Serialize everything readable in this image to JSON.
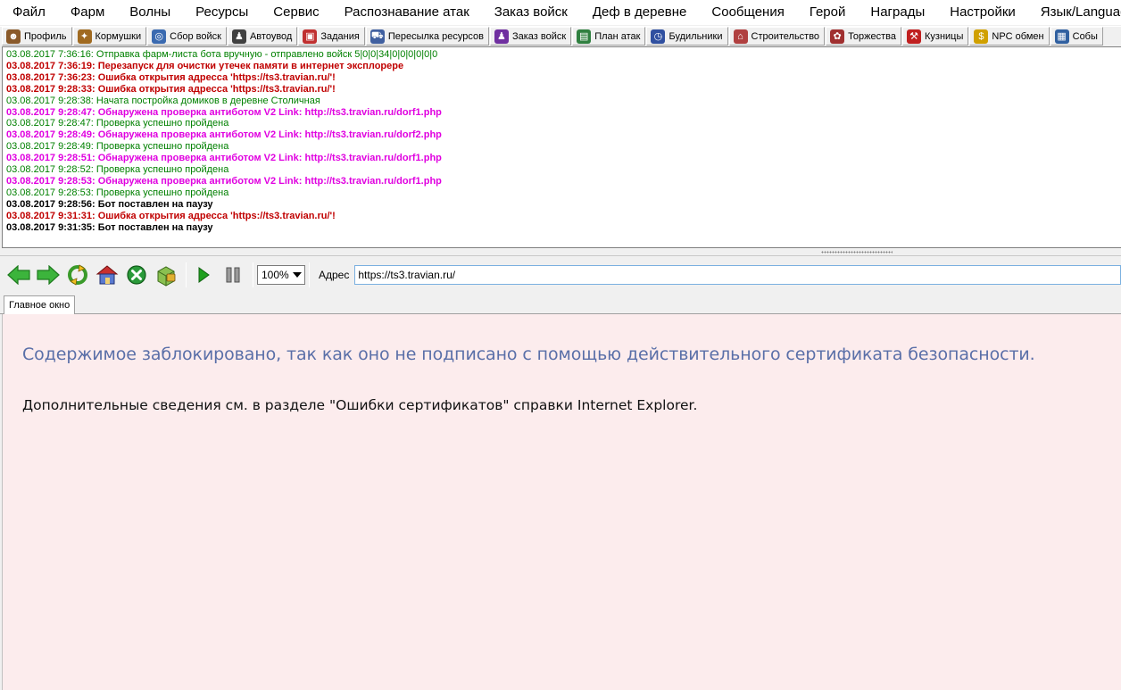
{
  "menu": [
    "Файл",
    "Фарм",
    "Волны",
    "Ресурсы",
    "Сервис",
    "Распознавание атак",
    "Заказ войск",
    "Деф в деревне",
    "Сообщения",
    "Герой",
    "Награды",
    "Настройки",
    "Язык/Language"
  ],
  "toolbar": [
    {
      "label": "Профиль",
      "icon": "profile-icon",
      "color": "#8a5a2a",
      "glyph": "☻"
    },
    {
      "label": "Кормушки",
      "icon": "feeder-icon",
      "color": "#a06a20",
      "glyph": "✦"
    },
    {
      "label": "Сбор войск",
      "icon": "gather-icon",
      "color": "#3a6ab0",
      "glyph": "◎"
    },
    {
      "label": "Автоувод",
      "icon": "autoevade-icon",
      "color": "#404040",
      "glyph": "♟"
    },
    {
      "label": "Задания",
      "icon": "tasks-icon",
      "color": "#c03030",
      "glyph": "▣"
    },
    {
      "label": "Пересылка ресурсов",
      "icon": "resources-icon",
      "color": "#4060a0",
      "glyph": "⛟"
    },
    {
      "label": "Заказ войск",
      "icon": "order-troops-icon",
      "color": "#7030a0",
      "glyph": "♟"
    },
    {
      "label": "План атак",
      "icon": "attack-plan-icon",
      "color": "#308040",
      "glyph": "▤"
    },
    {
      "label": "Будильники",
      "icon": "alarm-icon",
      "color": "#3050a0",
      "glyph": "◷"
    },
    {
      "label": "Строительство",
      "icon": "build-icon",
      "color": "#b04040",
      "glyph": "⌂"
    },
    {
      "label": "Торжества",
      "icon": "celebration-icon",
      "color": "#a03030",
      "glyph": "✿"
    },
    {
      "label": "Кузницы",
      "icon": "smithy-icon",
      "color": "#c02020",
      "glyph": "⚒"
    },
    {
      "label": "NPC обмен",
      "icon": "npc-exchange-icon",
      "color": "#d0a000",
      "glyph": "$"
    },
    {
      "label": "Собы",
      "icon": "events-icon",
      "color": "#3060a0",
      "glyph": "▦"
    }
  ],
  "log": [
    {
      "text": "03.08.2017 7:36:16: Отправка фарм-листа бота вручную - отправлено войск 5|0|0|34|0|0|0|0|0|0",
      "type": "green"
    },
    {
      "text": "03.08.2017 7:36:19: Перезапуск для очистки утечек памяти в интернет эксплорере",
      "type": "red"
    },
    {
      "text": "03.08.2017 7:36:23: Ошибка открытия адресса 'https://ts3.travian.ru/'!",
      "type": "red"
    },
    {
      "text": "03.08.2017 9:28:33: Ошибка открытия адресса 'https://ts3.travian.ru/'!",
      "type": "red"
    },
    {
      "text": "03.08.2017 9:28:38: Начата постройка домиков в деревне Столичная",
      "type": "green"
    },
    {
      "text": "03.08.2017 9:28:47: Обнаружена проверка антиботом V2 Link: http://ts3.travian.ru/dorf1.php",
      "type": "magenta"
    },
    {
      "text": "03.08.2017 9:28:47: Проверка успешно пройдена",
      "type": "green"
    },
    {
      "text": "03.08.2017 9:28:49: Обнаружена проверка антиботом V2 Link: http://ts3.travian.ru/dorf2.php",
      "type": "magenta"
    },
    {
      "text": "03.08.2017 9:28:49: Проверка успешно пройдена",
      "type": "green"
    },
    {
      "text": "03.08.2017 9:28:51: Обнаружена проверка антиботом V2 Link: http://ts3.travian.ru/dorf1.php",
      "type": "magenta"
    },
    {
      "text": "03.08.2017 9:28:52: Проверка успешно пройдена",
      "type": "green"
    },
    {
      "text": "03.08.2017 9:28:53: Обнаружена проверка антиботом V2 Link: http://ts3.travian.ru/dorf1.php",
      "type": "magenta"
    },
    {
      "text": "03.08.2017 9:28:53: Проверка успешно пройдена",
      "type": "green"
    },
    {
      "text": "03.08.2017 9:28:56: Бот поставлен на паузу",
      "type": "black"
    },
    {
      "text": "03.08.2017 9:31:31: Ошибка открытия адресса 'https://ts3.travian.ru/'!",
      "type": "red"
    },
    {
      "text": "03.08.2017 9:31:35: Бот поставлен на паузу",
      "type": "black"
    }
  ],
  "nav": {
    "zoom": "100%",
    "address_label": "Адрес",
    "address_value": "https://ts3.travian.ru/"
  },
  "tabs": [
    "Главное окно"
  ],
  "content": {
    "title": "Содержимое заблокировано, так как оно не подписано с помощью действительного сертификата безопасности.",
    "text": "Дополнительные сведения см. в разделе \"Ошибки сертификатов\" справки Internet Explorer."
  },
  "colors": {
    "log_green": "#008000",
    "log_red": "#c00000",
    "log_magenta": "#e000e0",
    "content_bg": "#fceced",
    "error_title": "#5a6fa8"
  }
}
